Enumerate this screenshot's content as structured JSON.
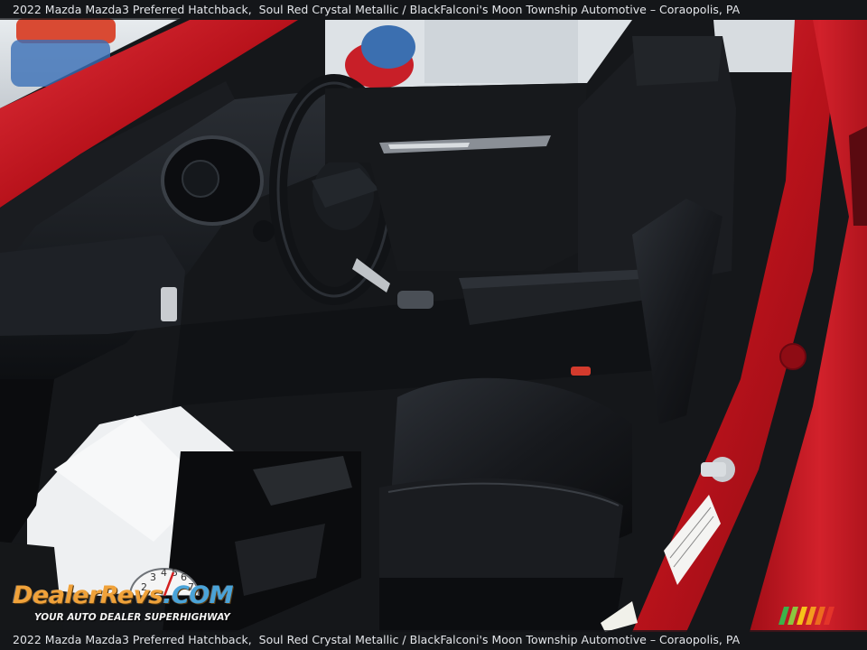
{
  "caption": {
    "vehicle": "2022 Mazda Mazda3 Preferred Hatchback,",
    "trim": "Soul Red Crystal Metallic / Black",
    "dealer": "Falconi's Moon Township Automotive – Coraopolis, PA"
  },
  "watermark": {
    "logo_part1": "DealerRevs",
    "logo_part2": ".COM",
    "tagline": "YOUR AUTO DEALER SUPERHIGHWAY",
    "gauge_digits": [
      "2",
      "3",
      "4",
      "5",
      "6",
      "7"
    ]
  },
  "colors": {
    "body_red": "#c0121c",
    "interior_black": "#15171a",
    "caption_bg": "#14161a"
  }
}
